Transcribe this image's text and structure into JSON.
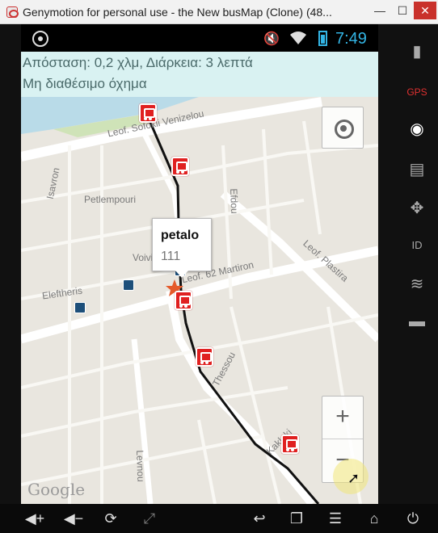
{
  "window": {
    "title": "Genymotion for personal use -  the New busMap (Clone) (48...",
    "minimize": "—",
    "maximize": "☐",
    "close": "✕"
  },
  "statusbar": {
    "time": "7:49",
    "colors": {
      "accent": "#33b5e5"
    }
  },
  "info": {
    "distance_text": "Απόσταση: 0,2 χλμ, Διάρκεια: 3 λεπτά",
    "vehicle_text": "Μη διαθέσιμο όχημα"
  },
  "map": {
    "streets": {
      "sofokli": "Leof. Sofokli Venizelou",
      "isavron": "Isavron",
      "petlempouri": "Petlempouri",
      "efdou": "Efdou",
      "voivis": "Voivis",
      "martiron": "Leof. 62 Martiron",
      "plastira": "Leof. Plastira",
      "eleftherias": "Eleftheris",
      "thessou": "Thessou",
      "kaklaki": "Kaklaki",
      "levnou": "Levnou"
    },
    "popup": {
      "title": "petalo",
      "number": "111"
    },
    "zoom_in": "+",
    "zoom_out": "−",
    "logo": "Google",
    "colors": {
      "route": "#111111",
      "stop": "#e02020",
      "background": "#e9e6df"
    }
  },
  "sidepanel": {
    "icons": [
      "battery-icon",
      "gps-icon",
      "webcam-icon",
      "capture-icon",
      "dpad-icon",
      "id-icon",
      "cast-icon",
      "sms-icon"
    ]
  },
  "navbar": {
    "icons": [
      "volume-up-icon",
      "volume-down-icon",
      "rotate-icon",
      "fullscreen-icon",
      "back-icon",
      "recent-apps-icon",
      "menu-icon",
      "home-icon",
      "power-icon"
    ]
  }
}
